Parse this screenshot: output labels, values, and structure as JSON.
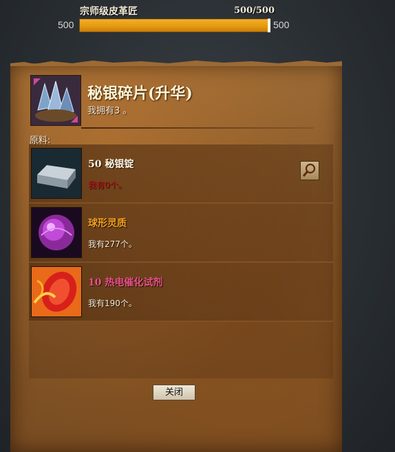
{
  "skill": {
    "title": "宗师级皮革匠",
    "value": "500/500",
    "min": "500",
    "max": "500",
    "progress": 1.0
  },
  "item": {
    "name": "秘银碎片(升华)",
    "owned": "我拥有3 。",
    "icon": "mithril-shard-icon"
  },
  "materials": {
    "label": "原料:",
    "rows": [
      {
        "name": "50 秘银锭",
        "owned": "我有0个。",
        "name_color": "#fff7e6",
        "owned_color": "#c4121a",
        "icon": "mithril-ingot-icon",
        "has_search": true
      },
      {
        "name": "球形灵质",
        "owned": "我有277个。",
        "name_color": "#f0a020",
        "owned_color": "#f4ead8",
        "icon": "glob-of-ectoplasm-icon",
        "has_search": false
      },
      {
        "name": "10 热电催化试剂",
        "owned": "我有190个。",
        "name_color": "#e8508a",
        "owned_color": "#f4ead8",
        "icon": "thermocatalytic-reagent-icon",
        "has_search": false
      }
    ]
  },
  "close_label": "关闭"
}
